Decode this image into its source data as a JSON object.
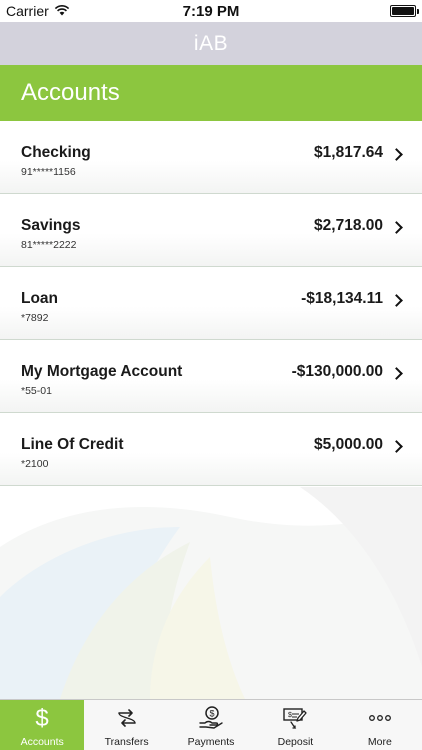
{
  "status_bar": {
    "carrier": "Carrier",
    "time": "7:19 PM"
  },
  "nav": {
    "title": "iAB"
  },
  "section": {
    "title": "Accounts"
  },
  "accounts": [
    {
      "name": "Checking",
      "number": "91*****1156",
      "balance": "$1,817.64"
    },
    {
      "name": "Savings",
      "number": "81*****2222",
      "balance": "$2,718.00"
    },
    {
      "name": "Loan",
      "number": "*7892",
      "balance": "-$18,134.11"
    },
    {
      "name": "My Mortgage Account",
      "number": "*55-01",
      "balance": "-$130,000.00"
    },
    {
      "name": "Line Of Credit",
      "number": "*2100",
      "balance": "$5,000.00"
    }
  ],
  "tabs": [
    {
      "label": "Accounts",
      "icon": "dollar-icon",
      "active": true
    },
    {
      "label": "Transfers",
      "icon": "transfer-arrows-icon",
      "active": false
    },
    {
      "label": "Payments",
      "icon": "hand-coin-icon",
      "active": false
    },
    {
      "label": "Deposit",
      "icon": "check-deposit-icon",
      "active": false
    },
    {
      "label": "More",
      "icon": "more-dots-icon",
      "active": false
    }
  ],
  "colors": {
    "accent": "#8cc63f",
    "nav_bar": "#d3d2dc"
  }
}
